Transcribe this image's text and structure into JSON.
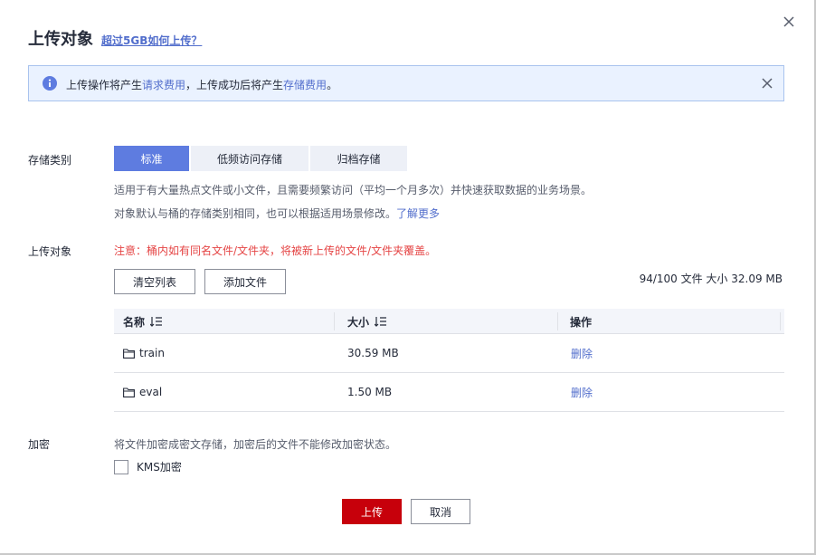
{
  "dialog": {
    "title": "上传对象",
    "title_link": "超过5GB如何上传？",
    "close_icon": "close-icon"
  },
  "notice": {
    "text_1": "上传操作将产生",
    "link_1": "请求费用",
    "text_2": "，上传成功后将产生",
    "link_2": "存储费用",
    "text_3": "。",
    "icon": "info-icon"
  },
  "storage": {
    "label": "存储类别",
    "options": [
      "标准",
      "低频访问存储",
      "归档存储"
    ],
    "selected": "标准",
    "hint_1": "适用于有大量热点文件或小文件，且需要频繁访问（平均一个月多次）并快速获取数据的业务场景。",
    "hint_2": "对象默认与桶的存储类别相同，也可以根据适用场景修改。",
    "hint_link": "了解更多"
  },
  "upload": {
    "label": "上传对象",
    "warning": "注意：桶内如有同名文件/文件夹，将被新上传的文件/文件夹覆盖。",
    "clear_button": "清空列表",
    "add_button": "添加文件",
    "summary": "94/100 文件  大小 32.09 MB"
  },
  "table": {
    "columns": [
      "名称",
      "大小",
      "操作"
    ],
    "rows": [
      {
        "name": "train",
        "size": "30.59 MB",
        "action": "删除"
      },
      {
        "name": "eval",
        "size": "1.50 MB",
        "action": "删除"
      }
    ]
  },
  "encryption": {
    "label": "加密",
    "hint": "将文件加密成密文存储，加密后的文件不能修改加密状态。",
    "checkbox_label": "KMS加密",
    "checked": false
  },
  "footer": {
    "upload_button": "上传",
    "cancel_button": "取消"
  },
  "colors": {
    "primary": "#c7000b",
    "accent": "#5e7ce0",
    "link": "#526ecc",
    "warning": "#e54545"
  }
}
